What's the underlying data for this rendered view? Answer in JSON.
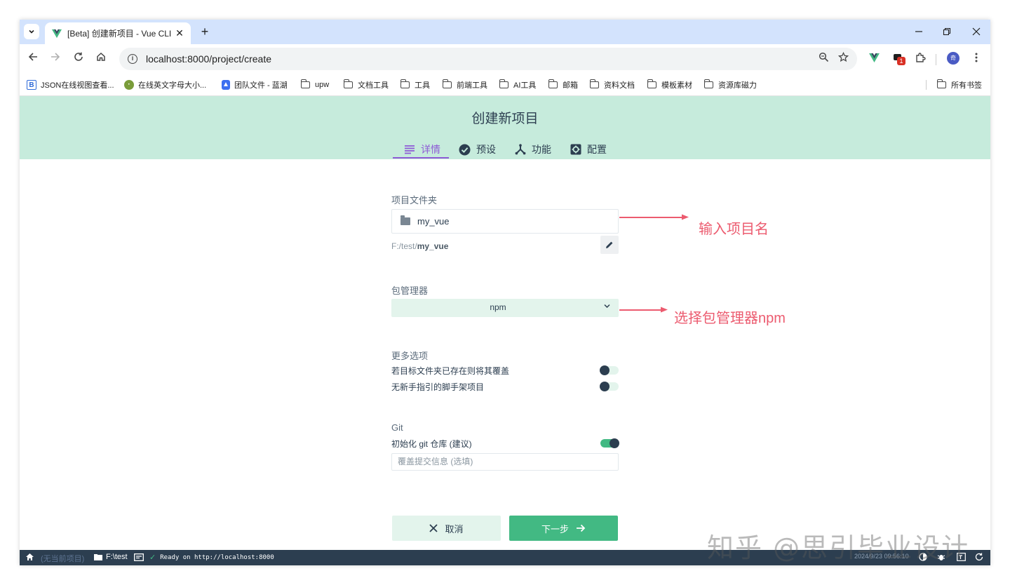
{
  "browser": {
    "tab_title": "[Beta] 创建新项目 - Vue CLI",
    "tab_close": "✕",
    "new_tab": "+",
    "url": "localhost:8000/project/create",
    "extension_badge": "1",
    "profile_initial": "奇"
  },
  "bookmarks": {
    "items": [
      {
        "label": "JSON在线视图查看..."
      },
      {
        "label": "在线英文字母大小..."
      },
      {
        "label": "团队文件 - 蓝湖"
      },
      {
        "label": "upw"
      },
      {
        "label": "文档工具"
      },
      {
        "label": "工具"
      },
      {
        "label": "前端工具"
      },
      {
        "label": "AI工具"
      },
      {
        "label": "邮箱"
      },
      {
        "label": "资料文档"
      },
      {
        "label": "模板素材"
      },
      {
        "label": "资源库磁力"
      }
    ],
    "all_bookmarks": "所有书签"
  },
  "header": {
    "title": "创建新项目",
    "tabs": [
      {
        "label": "详情",
        "active": true
      },
      {
        "label": "预设"
      },
      {
        "label": "功能"
      },
      {
        "label": "配置"
      }
    ]
  },
  "form": {
    "folder_label": "项目文件夹",
    "folder_value": "my_vue",
    "path_prefix": "F:/test/",
    "path_name": "my_vue",
    "pm_label": "包管理器",
    "pm_value": "npm",
    "more_label": "更多选项",
    "option_overwrite": "若目标文件夹已存在则将其覆盖",
    "option_overwrite_on": false,
    "option_bare": "无新手指引的脚手架项目",
    "option_bare_on": false,
    "git_label": "Git",
    "git_init": "初始化 git 仓库 (建议)",
    "git_init_on": true,
    "commit_placeholder": "覆盖提交信息 (选填)",
    "cancel_label": "取消",
    "next_label": "下一步"
  },
  "annotations": {
    "project_name": "输入项目名",
    "package_manager": "选择包管理器npm",
    "color": "#ec5b6f"
  },
  "statusbar": {
    "no_project": "(无当前项目)",
    "folder": "F:\\test",
    "log": "Ready on http://localhost:8000",
    "datetime": "2024/9/23 09:56:10"
  },
  "watermark": "知乎 @思引毕业设计",
  "colors": {
    "accent": "#42b983",
    "header_bg": "#c6ebdc",
    "active_tab": "#8e5bd6",
    "text": "#2c3e50"
  }
}
